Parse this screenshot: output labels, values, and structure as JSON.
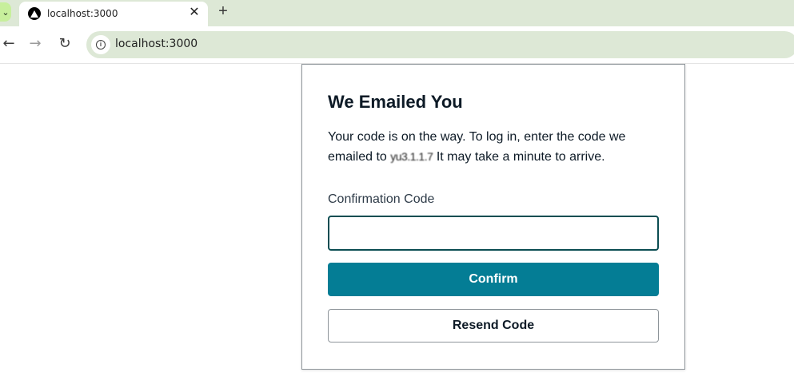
{
  "browser": {
    "tab": {
      "title": "localhost:3000",
      "close_glyph": "✕"
    },
    "tab_list_glyph": "⌄",
    "new_tab_glyph": "+",
    "nav": {
      "back_glyph": "←",
      "forward_glyph": "→",
      "reload_glyph": "↻"
    },
    "address": {
      "url": "localhost:3000",
      "info_glyph": "i"
    }
  },
  "confirm_card": {
    "title": "We Emailed You",
    "description_part1": "Your code is on the way. To log in, enter the code we emailed to ",
    "masked_email": "yu3.1.1.7",
    "description_part2": " It may take a minute to arrive.",
    "code_label": "Confirmation Code",
    "code_value": "",
    "confirm_label": "Confirm",
    "resend_label": "Resend Code"
  },
  "colors": {
    "primary": "#047d95",
    "input_border": "#0b4d52",
    "tab_strip": "#dde8d6"
  }
}
